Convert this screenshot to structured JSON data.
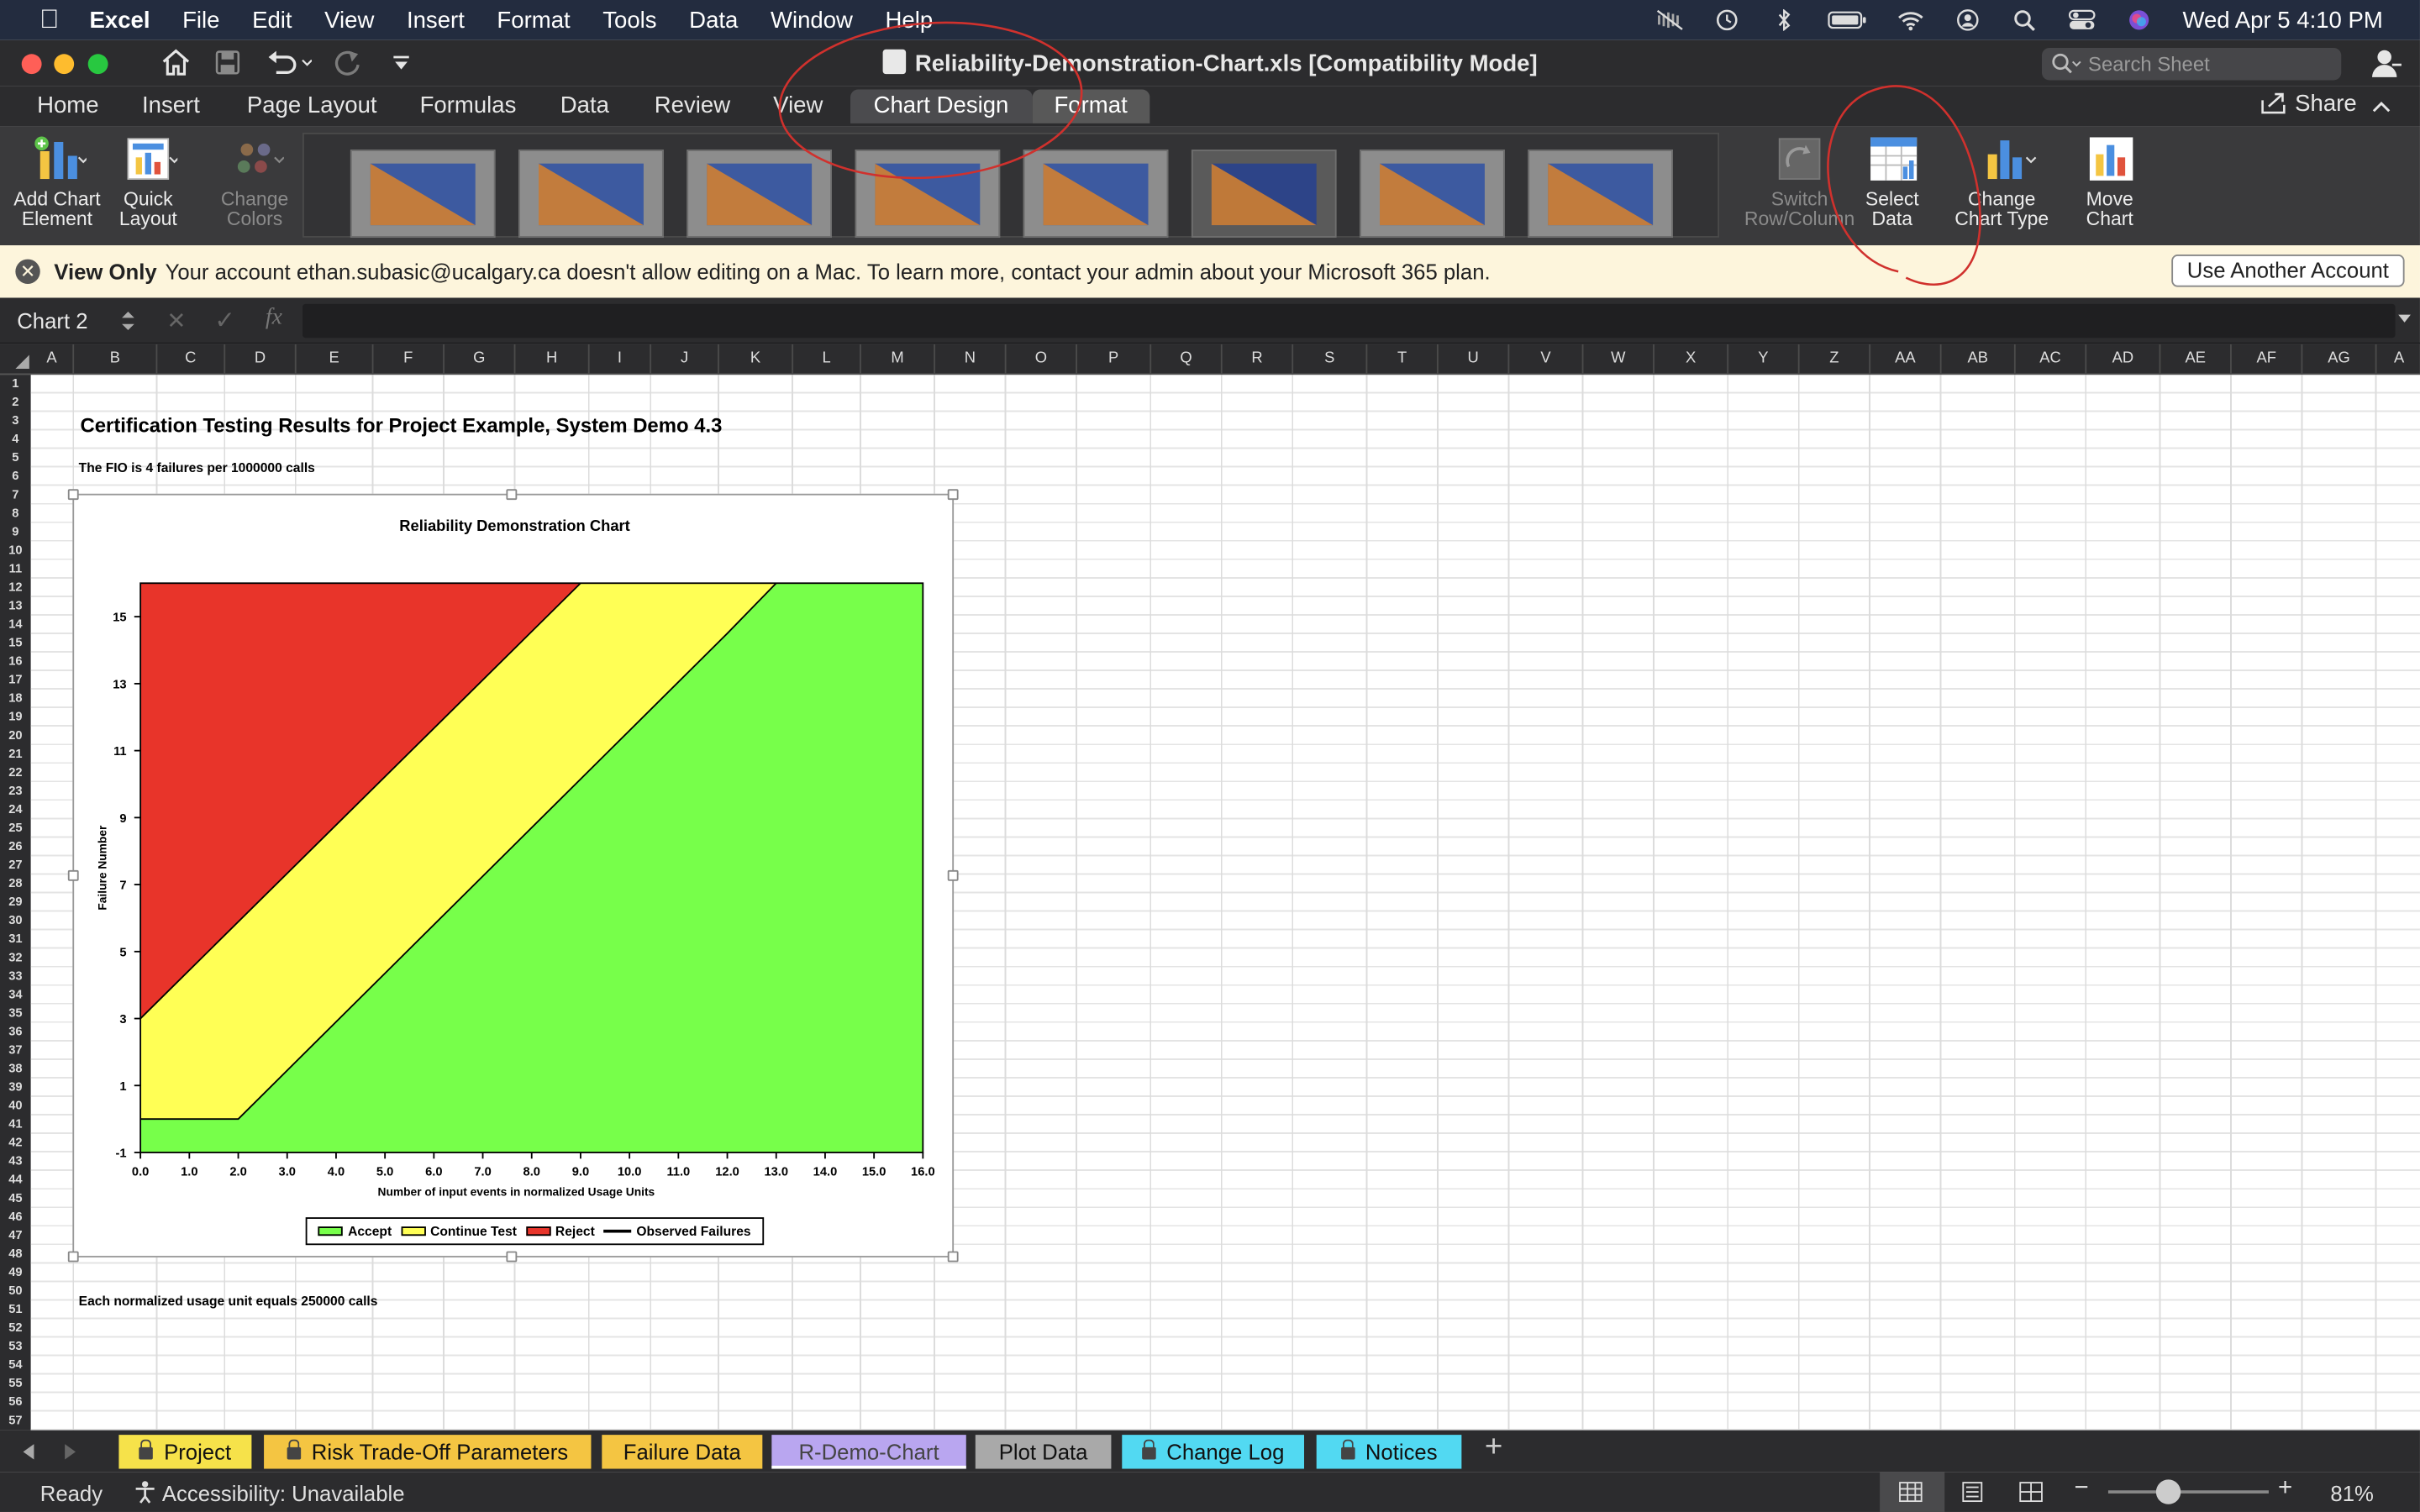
{
  "menubar": {
    "app": "Excel",
    "items": [
      "File",
      "Edit",
      "View",
      "Insert",
      "Format",
      "Tools",
      "Data",
      "Window",
      "Help"
    ],
    "clock": "Wed Apr 5  4:10 PM"
  },
  "window": {
    "title": "Reliability-Demonstration-Chart.xls  [Compatibility Mode]",
    "search_placeholder": "Search Sheet"
  },
  "ribbon_tabs": [
    "Home",
    "Insert",
    "Page Layout",
    "Formulas",
    "Data",
    "Review",
    "View",
    "Chart Design",
    "Format"
  ],
  "active_tab": "Chart Design",
  "share_label": "Share",
  "ribbon": {
    "add_chart_element": [
      "Add Chart",
      "Element"
    ],
    "quick_layout": [
      "Quick",
      "Layout"
    ],
    "change_colors": [
      "Change",
      "Colors"
    ],
    "switch_row_column": [
      "Switch",
      "Row/Column"
    ],
    "select_data": [
      "Select",
      "Data"
    ],
    "change_chart_type": [
      "Change",
      "Chart Type"
    ],
    "move_chart": [
      "Move",
      "Chart"
    ]
  },
  "infobar": {
    "title": "View Only",
    "message": "Your account ethan.subasic@ucalgary.ca doesn't allow editing on a Mac. To learn more, contact your admin about your Microsoft 365 plan.",
    "button": "Use Another Account"
  },
  "formula_bar": {
    "name_box": "Chart 2",
    "fx": "fx"
  },
  "columns": [
    "A",
    "B",
    "C",
    "D",
    "E",
    "F",
    "G",
    "H",
    "I",
    "J",
    "K",
    "L",
    "M",
    "N",
    "O",
    "P",
    "Q",
    "R",
    "S",
    "T",
    "U",
    "V",
    "W",
    "X",
    "Y",
    "Z",
    "AA",
    "AB",
    "AC",
    "AD",
    "AE",
    "AF",
    "AG",
    "A"
  ],
  "sheet_cells": {
    "title": "Certification Testing Results for Project Example, System Demo 4.3",
    "fio_note": "The FIO is 4 failures per 1000000 calls",
    "unit_note": "Each normalized usage unit equals 250000 calls"
  },
  "chart_data": {
    "type": "area",
    "title": "Reliability Demonstration Chart",
    "xlabel": "Number of input events in normalized Usage Units",
    "ylabel": "Failure Number",
    "xlim": [
      0,
      16
    ],
    "ylim": [
      -1,
      16
    ],
    "x_ticks": [
      "0.0",
      "1.0",
      "2.0",
      "3.0",
      "4.0",
      "5.0",
      "6.0",
      "7.0",
      "8.0",
      "9.0",
      "10.0",
      "11.0",
      "12.0",
      "13.0",
      "14.0",
      "15.0",
      "16.0"
    ],
    "y_ticks": [
      "-1",
      "1",
      "3",
      "5",
      "7",
      "9",
      "11",
      "13",
      "15"
    ],
    "legend": [
      "Accept",
      "Continue Test",
      "Reject",
      "Observed Failures"
    ],
    "colors": {
      "accept": "#77ff4a",
      "continue": "#ffff55",
      "reject": "#e8342a",
      "line": "#000000"
    },
    "series": [
      {
        "name": "Reject",
        "boundary": [
          [
            0,
            3
          ],
          [
            9.0,
            16
          ]
        ]
      },
      {
        "name": "Continue Test",
        "boundary": [
          [
            0,
            0
          ],
          [
            2.0,
            0
          ],
          [
            12.0,
            14.5
          ],
          [
            13.0,
            16
          ]
        ]
      },
      {
        "name": "Accept",
        "boundary": [
          [
            16,
            -1
          ]
        ]
      }
    ]
  },
  "sheet_tabs": [
    {
      "label": "Project",
      "color": "#f6e24a",
      "lock": true
    },
    {
      "label": "Risk Trade-Off Parameters",
      "color": "#f4c542",
      "lock": true
    },
    {
      "label": "Failure Data",
      "color": "#f4c542",
      "lock": false
    },
    {
      "label": "R-Demo-Chart",
      "color": "#b9a6f0",
      "lock": false,
      "active": true
    },
    {
      "label": "Plot Data",
      "color": "#a9a9a9",
      "lock": false
    },
    {
      "label": "Change Log",
      "color": "#52d9f2",
      "lock": true
    },
    {
      "label": "Notices",
      "color": "#52d9f2",
      "lock": true
    }
  ],
  "status": {
    "ready": "Ready",
    "accessibility": "Accessibility: Unavailable",
    "zoom": "81%"
  }
}
